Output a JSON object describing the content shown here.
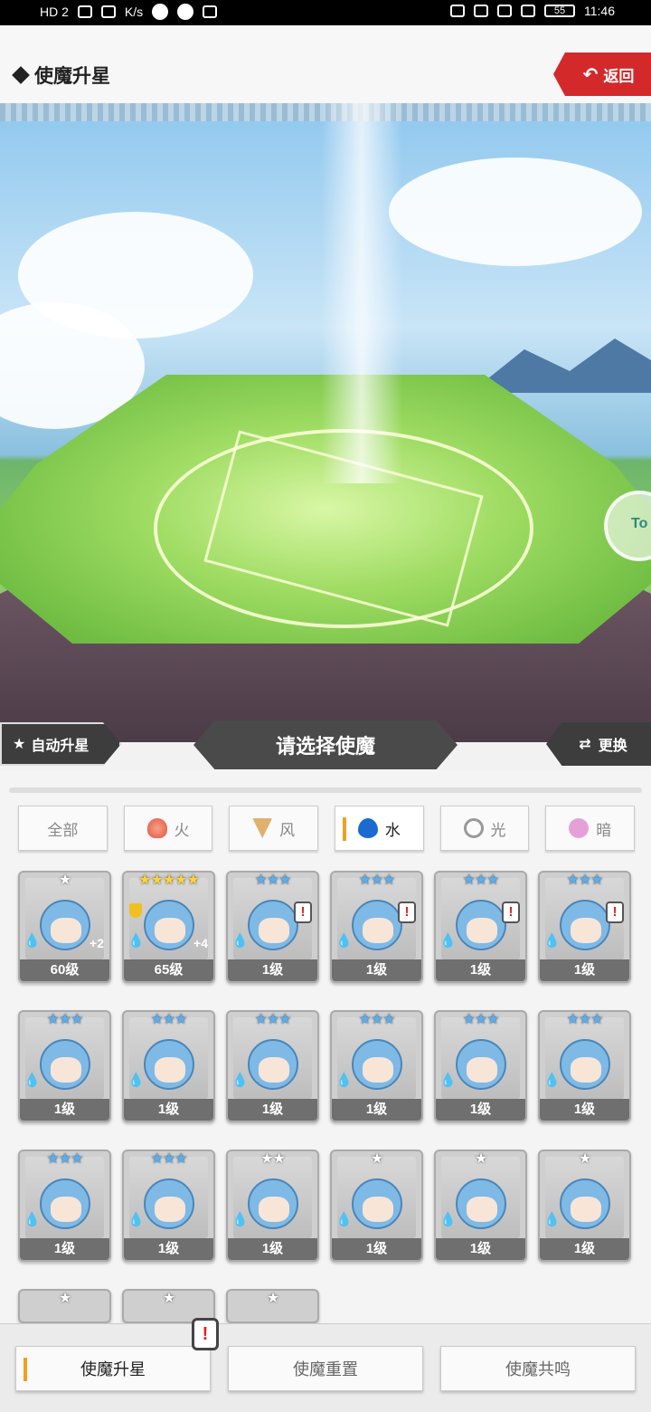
{
  "status_bar": {
    "network": "HD 2",
    "speed": "K/s",
    "time": "11:46",
    "battery": "55"
  },
  "header": {
    "title": "使魔升星",
    "back_label": "返回"
  },
  "scene": {
    "side_orb_text": "To"
  },
  "actions": {
    "auto_upgrade": "自动升星",
    "select_prompt": "请选择使魔",
    "swap": "更换"
  },
  "filters": [
    {
      "label": "全部",
      "icon": "none",
      "active": false
    },
    {
      "label": "火",
      "icon": "fire-icon",
      "active": false
    },
    {
      "label": "风",
      "icon": "wind-icon",
      "active": false
    },
    {
      "label": "水",
      "icon": "water-icon",
      "active": true
    },
    {
      "label": "光",
      "icon": "light-icon",
      "active": false
    },
    {
      "label": "暗",
      "icon": "dark-icon",
      "active": false
    }
  ],
  "familiars": [
    {
      "stars": "★",
      "level": "60级",
      "plus": "+2",
      "alert": false
    },
    {
      "stars": "★★★★★",
      "level": "65级",
      "plus": "+4",
      "alert": false
    },
    {
      "stars": "★★★",
      "level": "1级",
      "plus": "",
      "alert": true
    },
    {
      "stars": "★★★",
      "level": "1级",
      "plus": "",
      "alert": true
    },
    {
      "stars": "★★★",
      "level": "1级",
      "plus": "",
      "alert": true
    },
    {
      "stars": "★★★",
      "level": "1级",
      "plus": "",
      "alert": true
    },
    {
      "stars": "★★★",
      "level": "1级",
      "plus": "",
      "alert": false
    },
    {
      "stars": "★★★",
      "level": "1级",
      "plus": "",
      "alert": false
    },
    {
      "stars": "★★★",
      "level": "1级",
      "plus": "",
      "alert": false
    },
    {
      "stars": "★★★",
      "level": "1级",
      "plus": "",
      "alert": false
    },
    {
      "stars": "★★★",
      "level": "1级",
      "plus": "",
      "alert": false
    },
    {
      "stars": "★★★",
      "level": "1级",
      "plus": "",
      "alert": false
    },
    {
      "stars": "★★★",
      "level": "1级",
      "plus": "",
      "alert": false
    },
    {
      "stars": "★★★",
      "level": "1级",
      "plus": "",
      "alert": false
    },
    {
      "stars": "★★",
      "level": "1级",
      "plus": "",
      "alert": false
    },
    {
      "stars": "★",
      "level": "1级",
      "plus": "",
      "alert": false
    },
    {
      "stars": "★",
      "level": "1级",
      "plus": "",
      "alert": false
    },
    {
      "stars": "★",
      "level": "1级",
      "plus": "",
      "alert": false
    }
  ],
  "partial_row_stars": [
    "★",
    "★",
    "★"
  ],
  "bottom_tabs": [
    {
      "label": "使魔升星",
      "active": true
    },
    {
      "label": "使魔重置",
      "active": false
    },
    {
      "label": "使魔共鸣",
      "active": false
    }
  ],
  "colors": {
    "back_red": "#d3292b",
    "active_accent": "#f0a020",
    "water_blue": "#1c6ad0"
  }
}
